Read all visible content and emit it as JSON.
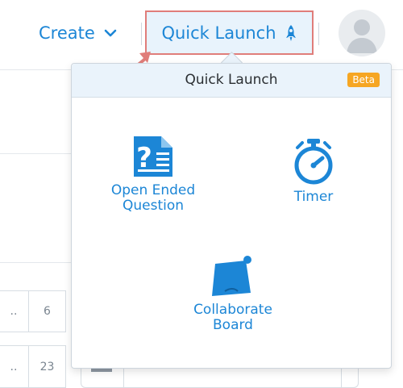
{
  "header": {
    "create_label": "Create",
    "quick_launch_label": "Quick Launch"
  },
  "quick_launch_menu": {
    "title": "Quick Launch",
    "badge": "Beta",
    "items": [
      {
        "label_line1": "Open Ended",
        "label_line2": "Question",
        "icon": "open-ended-question-icon"
      },
      {
        "label_line1": "Timer",
        "label_line2": "",
        "icon": "stopwatch-icon"
      },
      {
        "label_line1": "Collaborate",
        "label_line2": "Board",
        "icon": "collaborate-board-icon"
      }
    ]
  },
  "background_table": {
    "rows": [
      {
        "col1": "..",
        "col2": "6"
      },
      {
        "col1": "..",
        "col2": "23"
      }
    ]
  },
  "colors": {
    "accent": "#1c86d6",
    "highlight_border": "#e07d7a",
    "badge": "#f6a623",
    "menu_header": "#eaf3fb"
  }
}
